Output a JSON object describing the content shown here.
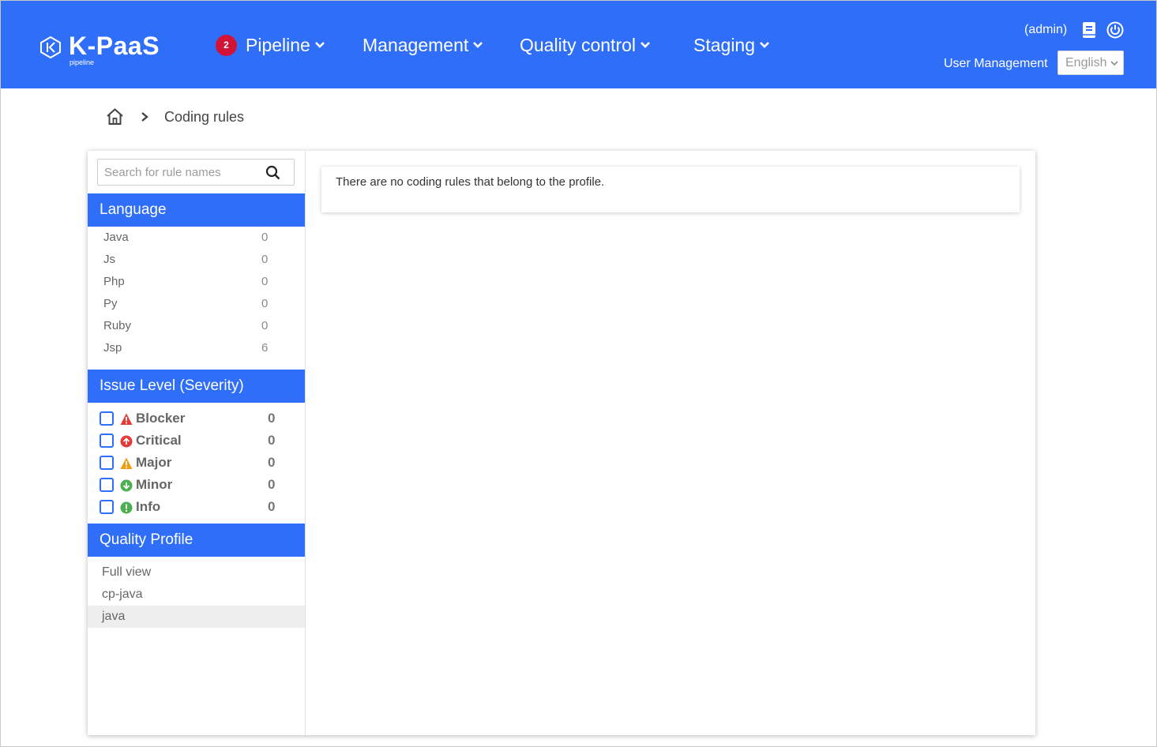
{
  "header": {
    "logo_text": "K-PaaS",
    "logo_sub": "pipeline",
    "nav": [
      {
        "label": "Pipeline",
        "badge": "2"
      },
      {
        "label": "Management"
      },
      {
        "label": "Quality control"
      },
      {
        "label": "Staging"
      }
    ],
    "user": "(admin)",
    "user_management": "User Management",
    "language": "English",
    "icons": [
      "manual-book-icon",
      "power-icon"
    ],
    "accent_color": "#2f6ef9",
    "badge_color": "#d21236"
  },
  "breadcrumb": {
    "home_icon": "home-icon",
    "current": "Coding rules"
  },
  "sidebar": {
    "search_placeholder": "Search for rule names",
    "language": {
      "title": "Language",
      "items": [
        {
          "name": "Java",
          "count": "0"
        },
        {
          "name": "Js",
          "count": "0"
        },
        {
          "name": "Php",
          "count": "0"
        },
        {
          "name": "Py",
          "count": "0"
        },
        {
          "name": "Ruby",
          "count": "0"
        },
        {
          "name": "Jsp",
          "count": "6"
        }
      ]
    },
    "severity": {
      "title": "Issue Level (Severity)",
      "items": [
        {
          "name": "Blocker",
          "count": "0",
          "icon": "blocker-icon",
          "color": "#e53935"
        },
        {
          "name": "Critical",
          "count": "0",
          "icon": "critical-icon",
          "color": "#e53935"
        },
        {
          "name": "Major",
          "count": "0",
          "icon": "major-icon",
          "color": "#f39c12"
        },
        {
          "name": "Minor",
          "count": "0",
          "icon": "minor-icon",
          "color": "#4caf50"
        },
        {
          "name": "Info",
          "count": "0",
          "icon": "info-icon",
          "color": "#4caf50"
        }
      ]
    },
    "quality_profile": {
      "title": "Quality Profile",
      "items": [
        {
          "name": "Full view"
        },
        {
          "name": "cp-java"
        },
        {
          "name": "java",
          "selected": true
        }
      ]
    }
  },
  "main": {
    "empty_message": "There are no coding rules that belong to the profile."
  }
}
